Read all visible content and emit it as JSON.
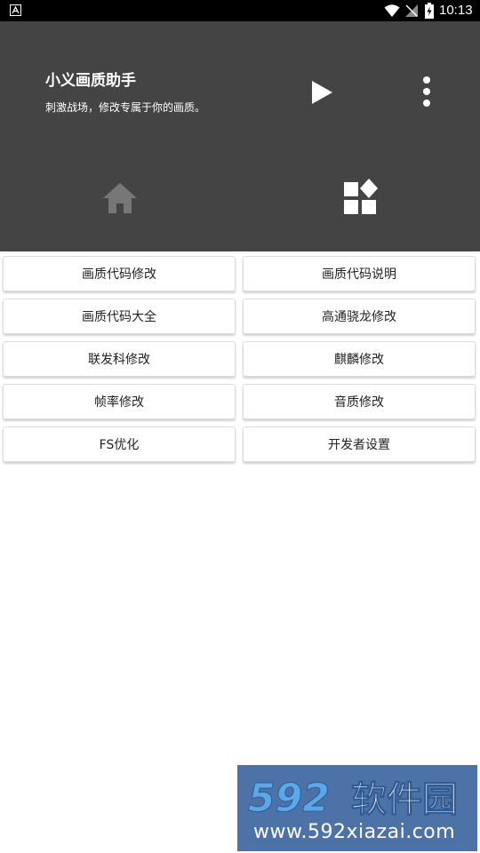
{
  "status_bar": {
    "time": "10:13"
  },
  "header": {
    "title": "小义画质助手",
    "subtitle": "刺激战场，修改专属于你的画质。"
  },
  "nav": {
    "tabs": [
      {
        "icon": "home-icon"
      },
      {
        "icon": "apps-icon"
      }
    ]
  },
  "grid": {
    "buttons": [
      {
        "label": "画质代码修改"
      },
      {
        "label": "画质代码说明"
      },
      {
        "label": "画质代码大全"
      },
      {
        "label": "高通骁龙修改"
      },
      {
        "label": "联发科修改"
      },
      {
        "label": "麒麟修改"
      },
      {
        "label": "帧率修改"
      },
      {
        "label": "音质修改"
      },
      {
        "label": "FS优化"
      },
      {
        "label": "开发者设置"
      }
    ]
  },
  "watermark": {
    "number": "592",
    "brand": "软件园",
    "url": "www.592xiazai.com"
  },
  "colors": {
    "header_bg": "#444444",
    "status_bg": "#000000",
    "home_icon": "#777777",
    "apps_icon": "#ffffff",
    "watermark_bg": "#4d72a8"
  }
}
